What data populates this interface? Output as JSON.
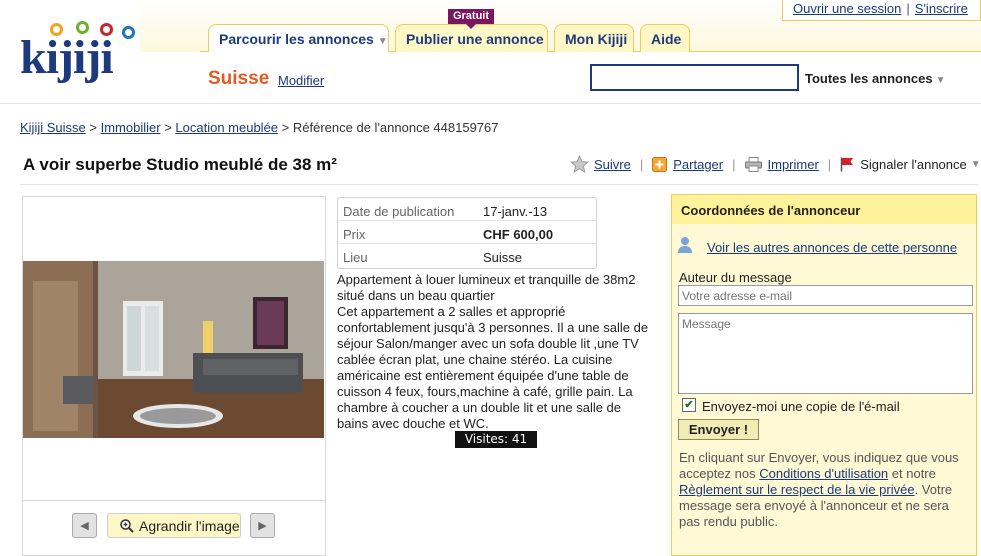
{
  "header": {
    "logo_text": "kijiji",
    "tabs": [
      {
        "label": "Parcourir les annonces",
        "has_caret": true,
        "active": true
      },
      {
        "label": "Publier une annonce",
        "badge": "Gratuit"
      },
      {
        "label": "Mon Kijiji"
      },
      {
        "label": "Aide"
      }
    ],
    "session": {
      "login": "Ouvrir une session",
      "separator": "|",
      "register": "S'inscrire"
    },
    "region": "Suisse",
    "region_modify": "Modifier",
    "search": {
      "value": "",
      "scope": "Toutes les annonces"
    }
  },
  "breadcrumb": {
    "items": [
      "Kijiji Suisse",
      "Immobilier",
      "Location meublée"
    ],
    "separator": ">",
    "reference": "Référence de l'annonce 448159767"
  },
  "ad": {
    "title": "A voir superbe Studio meublé de 38 m²",
    "actions": [
      {
        "label": "Suivre",
        "icon": "star-icon"
      },
      {
        "label": "Partager",
        "icon": "share-icon"
      },
      {
        "label": "Imprimer",
        "icon": "printer-icon"
      },
      {
        "label": "Signaler l'annonce",
        "icon": "flag-icon",
        "has_caret": true
      }
    ],
    "info": [
      {
        "key": "Date de publication",
        "value": "17-janv.-13"
      },
      {
        "key": "Prix",
        "value": "CHF 600,00"
      },
      {
        "key": "Lieu",
        "value": "Suisse"
      }
    ],
    "description": [
      "Appartement à louer lumineux et tranquille de 38m2 situé dans un beau quartier",
      "Cet appartement a 2 salles et approprié confortablement jusqu'à 3 personnes. Il a une salle de séjour Salon/manger avec un sofa double lit ,une TV cablée écran plat, une chaine stéréo. La cuisine américaine est entièrement équipée d'une table de cuisson 4 feux, fours,machine à café, grille pain. La chambre à coucher a un double lit et une salle de bains avec douche et WC."
    ],
    "visits": "Visites: 41",
    "enlarge_label": "Agrandir l'image"
  },
  "contact": {
    "heading": "Coordonnées de l'annonceur",
    "other_ads_link": "Voir les autres annonces de cette personne",
    "author_label": "Auteur du message",
    "email_placeholder": "Votre adresse e-mail",
    "message_placeholder": "Message",
    "copy_checked": true,
    "copy_label": "Envoyez-moi une copie de l'é-mail",
    "send_label": "Envoyer !",
    "disclaimer_1": "En cliquant sur Envoyer, vous indiquez que vous acceptez nos ",
    "terms_link": "Conditions d'utilisation",
    "disclaimer_2": " et notre ",
    "privacy_link": "Règlement sur le respect de la vie privée",
    "disclaimer_3": ". Votre message sera envoyé à l'annonceur et ne sera pas rendu public."
  },
  "colors": {
    "brand_blue": "#1d3a7e",
    "region_orange": "#e55a22",
    "tab_yellow": "#fff8c6",
    "badge_purple": "#7b1760",
    "contact_bg": "#fff9d6"
  }
}
